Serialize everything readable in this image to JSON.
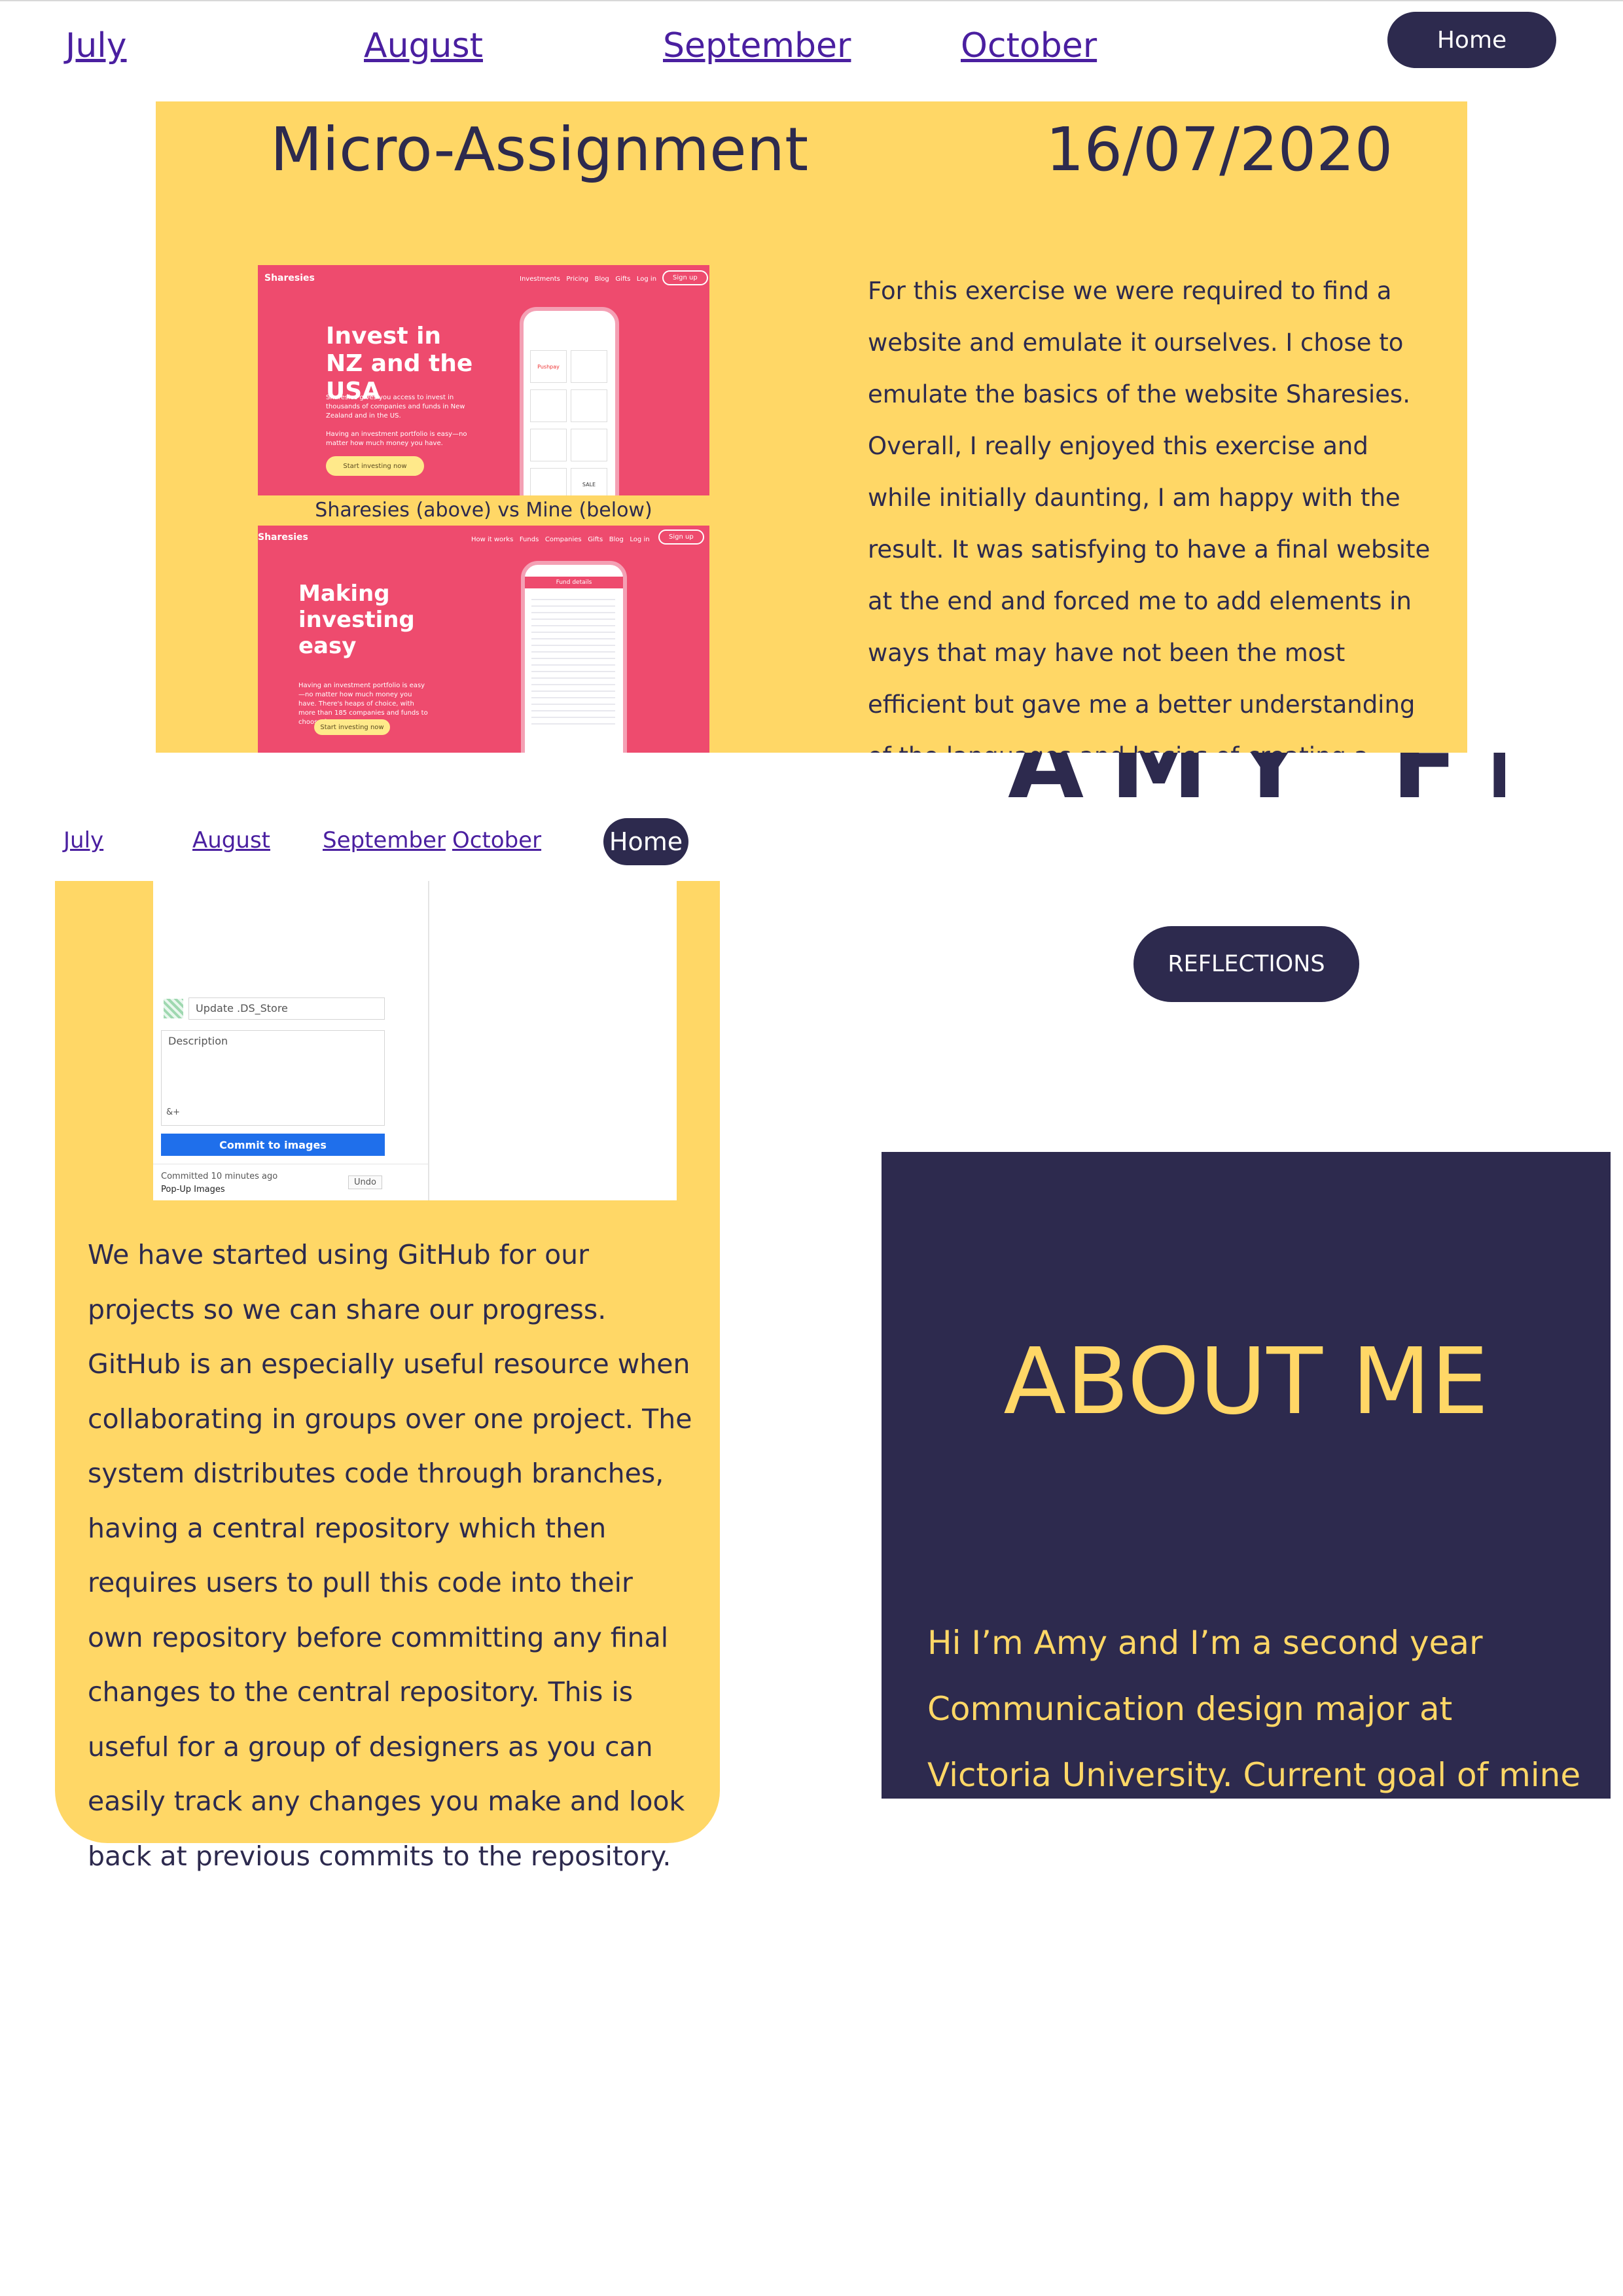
{
  "nav_top": {
    "links": [
      "July",
      "August",
      "September",
      "October"
    ],
    "home": "Home"
  },
  "panel1": {
    "title": "Micro-Assignment",
    "date": "16/07/2020",
    "caption": "Sharesies (above) vs Mine (below)",
    "text": "For this exercise we were required to find a website and emulate it ourselves. I chose to emulate the basics of the website Sharesies. Overall, I really enjoyed this exercise and while initially daunting, I am happy with the result. It was satisfying to have a final website at the end and forced me to add elements in ways that may have not been the most efficient but gave me a better understanding of the languages and basics of creating a website. For now, the most",
    "shot1": {
      "logo": "Sharesies",
      "nav": [
        "Investments",
        "Pricing",
        "Blog",
        "Gifts",
        "Log in"
      ],
      "signup": "Sign up",
      "hero": "Invest in NZ and the USA",
      "body": "Sharesies gives you access to invest in thousands of companies and funds in New Zealand and in the US.",
      "body2": "Having an investment portfolio is easy—no matter how much money you have.",
      "cta": "Start investing now",
      "phone_labels": [
        "Pushpay",
        "SALE"
      ]
    },
    "shot2": {
      "logo": "Sharesies",
      "nav": [
        "How it works",
        "Funds",
        "Companies",
        "Gifts",
        "Blog",
        "Log in"
      ],
      "signup": "Sign up",
      "hero": "Making investing easy",
      "body": "Having an investment portfolio is easy—no matter how much money you have. There's heaps of choice, with more than 185 companies and funds to choose from.",
      "cta": "Start investing now",
      "phone_title": "Fund details"
    }
  },
  "ghost_heading": "AMY FLYNN",
  "nav_second": {
    "links": [
      "July",
      "August",
      "September",
      "October"
    ],
    "home": "Home"
  },
  "panel2": {
    "github": {
      "summary_placeholder": "Update .DS_Store",
      "description_placeholder": "Description",
      "coauthor": "&+",
      "commit_button": "Commit to images",
      "committed": "Committed 10 minutes ago",
      "committed_msg": "Pop-Up Images",
      "undo": "Undo"
    },
    "text": "We have started using GitHub for our projects so we can share our progress. GitHub is an especially useful resource when collaborating in groups over one project. The system distributes code through branches, having a central repository which then requires users to pull this code into their own repository before committing any final changes to the central repository. This is useful for a group of designers as you can easily track any changes you make and look back at previous commits to the repository."
  },
  "reflections_button": "REFLECTIONS",
  "about": {
    "heading": "ABOUT ME",
    "text": "Hi I’m Amy and I’m a second year Communication design major at Victoria University. Current goal of mine is to focus"
  },
  "colors": {
    "navy": "#2d2a4e",
    "yellow": "#ffd766",
    "pink": "#ee4b6e",
    "link": "#4a1fa0"
  }
}
